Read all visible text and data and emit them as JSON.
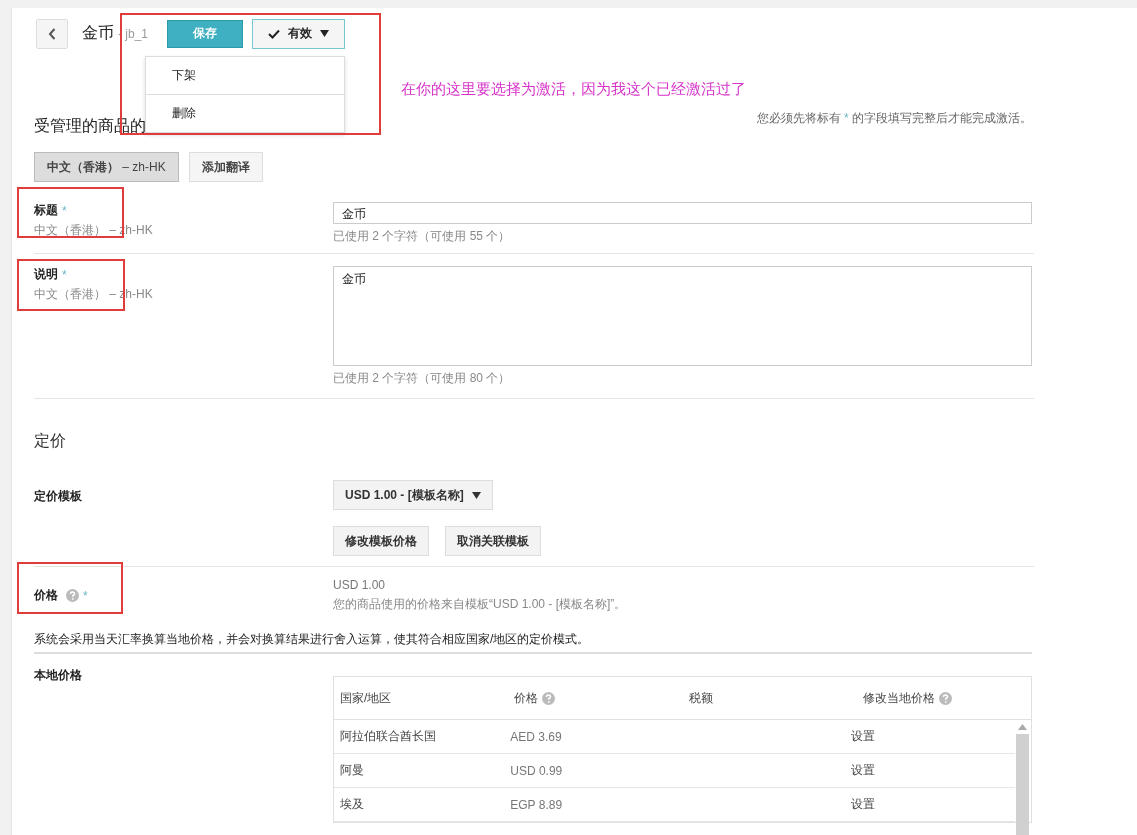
{
  "header": {
    "title": "金币",
    "id": "- jb_1",
    "save": "保存",
    "status": {
      "label": "有效",
      "checked": true
    }
  },
  "status_menu": {
    "expanded": true,
    "items": [
      "下架",
      "删除"
    ]
  },
  "annotation": "在你的这里要选择为激活，因为我这个已经激活过了",
  "section_title": "受管理的商品的",
  "activation_note": {
    "before": "您必须先将标有 ",
    "mark": "*",
    "after": " 的字段填写完整后才能完成激活。"
  },
  "languages": [
    {
      "label": "中文（香港）",
      "code": " – zh-HK",
      "selected": true
    }
  ],
  "add_translation": "添加翻译",
  "fields": [
    {
      "kind": "text",
      "label": "标题",
      "required": "*",
      "language": "中文（香港） – zh-HK",
      "value": "金币",
      "counter": "已使用 2 个字符（可使用 55 个）"
    },
    {
      "kind": "textarea",
      "label": "说明",
      "required": "*",
      "language": "中文（香港） – zh-HK",
      "value": "金币",
      "counter": "已使用 2 个字符（可使用 80 个）"
    }
  ],
  "pricing": {
    "heading": "定价",
    "template_label": "定价模板",
    "template_select": "USD 1.00 - [模板名称]",
    "buttons": [
      "修改模板价格",
      "取消关联模板"
    ],
    "price_label": "价格",
    "price_help": true,
    "price_required": "*",
    "price_value": "USD 1.00",
    "price_note": "您的商品使用的价格来自模板“USD 1.00 - [模板名称]”。",
    "exchange_note": "系统会采用当天汇率换算当地价格，并会对换算结果进行舍入运算，使其符合相应国家/地区的定价模式。",
    "local_label": "本地价格"
  },
  "table": {
    "columns": [
      {
        "label": "国家/地区",
        "help": false
      },
      {
        "label": "价格",
        "help": true
      },
      {
        "label": "税额",
        "help": false
      },
      {
        "label": "修改当地价格",
        "help": true
      }
    ],
    "rows": [
      [
        "阿拉伯联合酋长国",
        "AED 3.69",
        "",
        "设置"
      ],
      [
        "阿曼",
        "USD 0.99",
        "",
        "设置"
      ],
      [
        "埃及",
        "EGP 8.89",
        "",
        "设置"
      ]
    ]
  }
}
